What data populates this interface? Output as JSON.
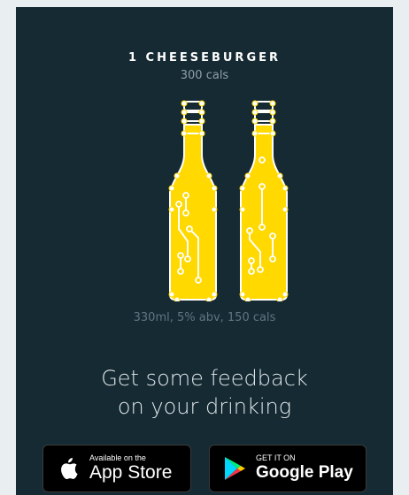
{
  "food": {
    "name": "1 CHEESEBURGER",
    "calories": "300 cals"
  },
  "drink": {
    "count": 2,
    "icon": "beer-bottle-icon",
    "fill_color": "#ffd900",
    "line_color": "#ffffff",
    "description": "330ml, 5% abv, 150 cals"
  },
  "headline": {
    "line1": "Get some feedback",
    "line2": "on your drinking"
  },
  "stores": {
    "apple": {
      "small": "Available on the",
      "big": "App Store",
      "icon": "apple-icon"
    },
    "google": {
      "small": "GET IT ON",
      "big": "Google Play",
      "icon": "google-play-icon"
    }
  },
  "colors": {
    "background": "#162a33",
    "page": "#e9eff1"
  }
}
